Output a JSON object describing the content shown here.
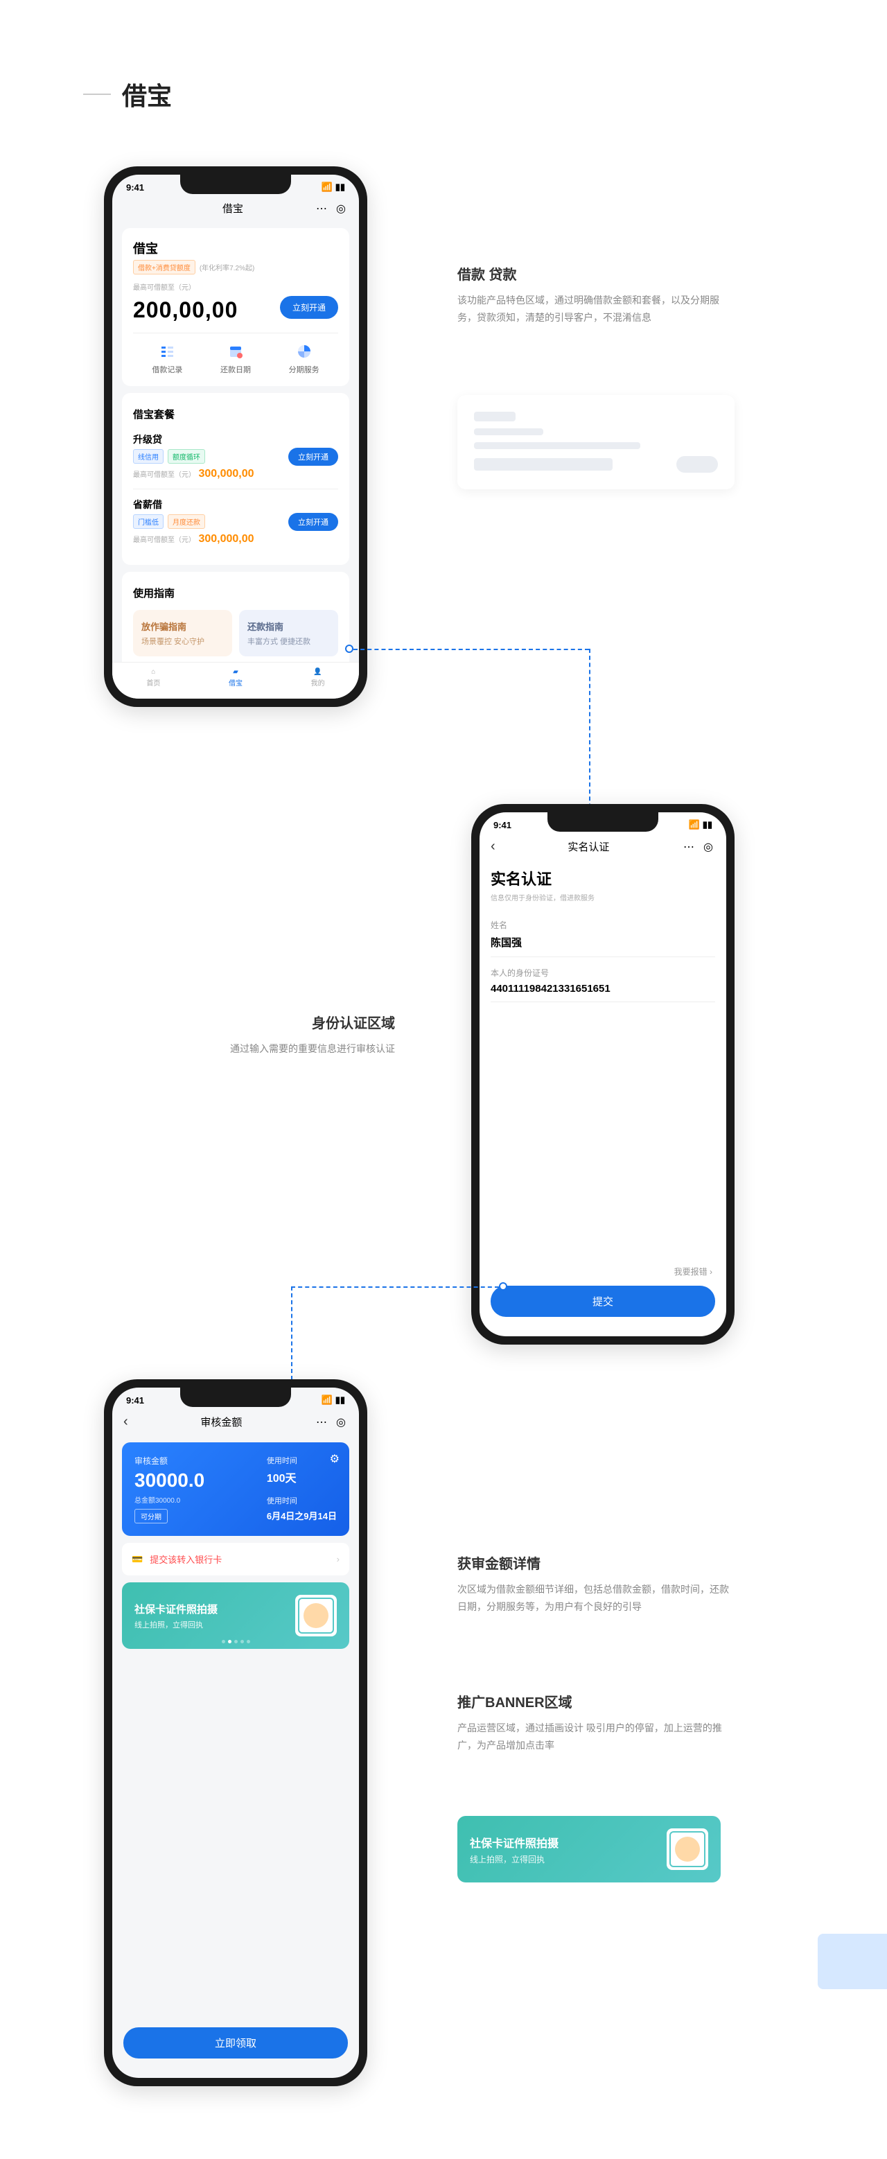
{
  "pageTitle": "借宝",
  "statusTime": "9:41",
  "phone1": {
    "navTitle": "借宝",
    "cardTitle": "借宝",
    "tagText": "借款+消费贷额度",
    "rateNote": "(年化利率7.2%起)",
    "limitLabel": "最高可借额至（元）",
    "amount": "200,00,00",
    "openBtn": "立刻开通",
    "grid": {
      "item1": "借款记录",
      "item2": "还款日期",
      "item3": "分期服务"
    },
    "packagesTitle": "借宝套餐",
    "pkg1": {
      "name": "升级贷",
      "tag1": "线信用",
      "tag2": "额度循环",
      "limitLabel": "最高可借额至（元）",
      "amount": "300,000,00"
    },
    "pkg2": {
      "name": "省薪借",
      "tag1": "门槛低",
      "tag2": "月度还款",
      "limitLabel": "最高可借额至（元）",
      "amount": "300,000,00"
    },
    "guideTitle": "使用指南",
    "guide1": {
      "title": "放作骗指南",
      "sub": "场景覆控 安心守护"
    },
    "guide2": {
      "title": "还款指南",
      "sub": "丰富方式 便捷还款"
    },
    "tabs": {
      "home": "首页",
      "loan": "借宝",
      "mine": "我的"
    }
  },
  "annotation1": {
    "title": "借款 贷款",
    "text": "该功能产品特色区域，通过明确借款金额和套餐，以及分期服务，贷款须知，清楚的引导客户，不混淆信息"
  },
  "phone2": {
    "navTitle": "实名认证",
    "heading": "实名认证",
    "subheading": "信息仅用于身份验证，借进款服务",
    "nameLabel": "姓名",
    "nameValue": "陈国强",
    "idLabel": "本人的身份证号",
    "idValue": "440111198421331651651",
    "reportLink": "我要报错",
    "submitBtn": "提交"
  },
  "annotation2": {
    "title": "身份认证区域",
    "text": "通过输入需要的重要信息进行审核认证"
  },
  "phone3": {
    "navTitle": "审核金额",
    "blueCard": {
      "label": "审核金额",
      "amount": "30000.0",
      "totalLabel": "总金额30000.0",
      "installment": "可分期",
      "timeLabel": "使用时间",
      "timeValue": "100天",
      "dateLabel": "使用时间",
      "dateValue": "6月4日之9月14日"
    },
    "bankText": "提交该转入银行卡",
    "promo": {
      "title": "社保卡证件照拍摄",
      "sub": "线上拍照，立得回执"
    },
    "claimBtn": "立即领取"
  },
  "annotation3": {
    "title": "获审金额详情",
    "text": "次区域为借款金额细节详细，包括总借款金额，借款时间，还款日期，分期服务等，为用户有个良好的引导"
  },
  "annotation4": {
    "title": "推广BANNER区域",
    "text": "产品运营区域，通过插画设计 吸引用户的停留，加上运营的推广，为产品增加点击率"
  },
  "bannerStandalone": {
    "title": "社保卡证件照拍摄",
    "sub": "线上拍照，立得回执"
  }
}
